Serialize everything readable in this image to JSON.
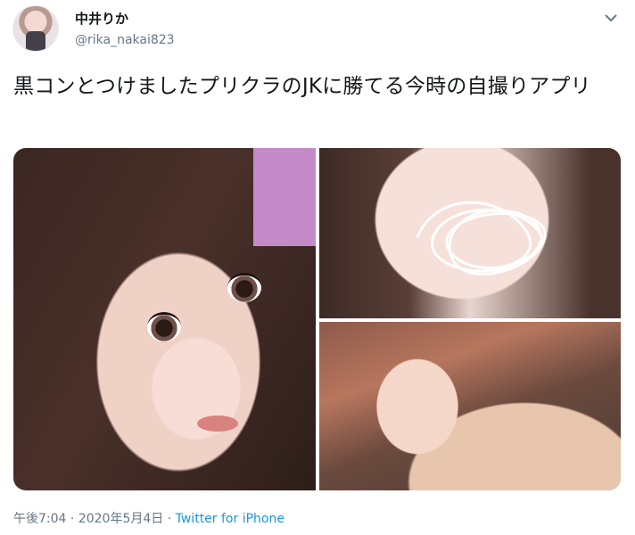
{
  "user": {
    "display_name": "中井りか",
    "handle": "@rika_nakai823"
  },
  "tweet": {
    "text": "黒コンとつけましたプリクラのJKに勝てる今時の自撮りアプリ",
    "time": "午後7:04",
    "separator": "·",
    "date": "2020年5月4日",
    "source": "Twitter for iPhone"
  },
  "media": {
    "count": 3
  },
  "icons": {
    "menu": "chevron-down-icon"
  },
  "colors": {
    "text": "#14171a",
    "secondary": "#657786",
    "link": "#1b95e0"
  }
}
